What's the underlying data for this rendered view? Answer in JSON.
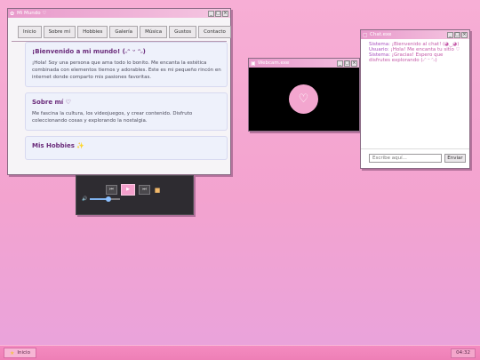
{
  "main_window": {
    "title": "Mi Mundo ♡",
    "nav": [
      "Inicio",
      "Sobre mí",
      "Hobbies",
      "Galería",
      "Música",
      "Gustos",
      "Contacto"
    ],
    "cards": [
      {
        "heading": "¡Bienvenido a mi mundo! (˶ᵔ ᵕ ᵔ˶)",
        "text": "¡Hola! Soy una persona que ama todo lo bonito. Me encanta la estética combinada con elementos tiernos y adorables. Este es mi pequeño rincón en internet donde comparto mis pasiones favoritas."
      },
      {
        "heading": "Sobre mí ♡",
        "text": "Me fascina la cultura, los videojuegos, y crear contenido. Disfruto coleccionando cosas y explorando la nostalgia."
      },
      {
        "heading": "Mis Hobbies ✨",
        "text": ""
      }
    ]
  },
  "player": {
    "prev": "⏮",
    "play": "▶",
    "next": "⏭",
    "stop": "■",
    "volume_icon": "🔊",
    "volume": 0.6
  },
  "webcam": {
    "title": "Webcam.exe",
    "heart": "♡"
  },
  "chat": {
    "title": "Chat.exe",
    "messages": [
      {
        "who": "Sistema:",
        "text": "¡Bienvenido al chat! (◕‿◕)"
      },
      {
        "who": "Usuario:",
        "text": "¡Hola! Me encanta tu sitio ♡"
      },
      {
        "who": "Sistema:",
        "text": "¡Gracias! Espero que disfrutes explorando (˶ᵔ ᵕ ᵔ˶)"
      }
    ],
    "input_placeholder": "Escribe aquí...",
    "send_label": "Enviar"
  },
  "taskbar": {
    "start_label": "Inicio",
    "clock": "04:32"
  },
  "colors": {
    "desktop_top": "#f7aed5",
    "desktop_bottom": "#e9a3dc",
    "accent_pink": "#f3a6cf",
    "heading_purple": "#6a2b7a"
  }
}
